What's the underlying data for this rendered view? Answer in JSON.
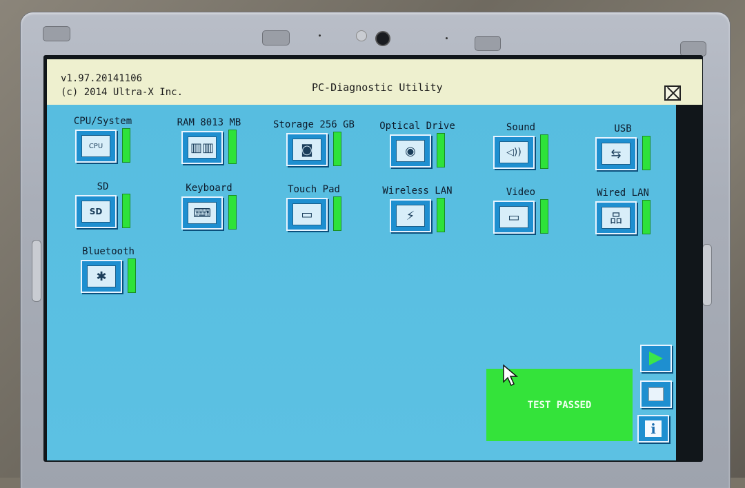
{
  "header": {
    "version": "v1.97.20141106",
    "copyright": "(c) 2014 Ultra-X Inc.",
    "title": "PC-Diagnostic Utility"
  },
  "devices": [
    {
      "label": "CPU/System",
      "icon": "cpu-icon",
      "glyph": "CPU"
    },
    {
      "label": "RAM 8013 MB",
      "icon": "ram-icon",
      "glyph": "▥▥"
    },
    {
      "label": "Storage 256 GB",
      "icon": "storage-icon",
      "glyph": "◙"
    },
    {
      "label": "Optical Drive",
      "icon": "optical-drive-icon",
      "glyph": "◉"
    },
    {
      "label": "Sound",
      "icon": "speaker-icon",
      "glyph": "◁))"
    },
    {
      "label": "USB",
      "icon": "usb-icon",
      "glyph": "⇆"
    },
    {
      "label": "SD",
      "icon": "sd-card-icon",
      "glyph": "SD"
    },
    {
      "label": "Keyboard",
      "icon": "keyboard-icon",
      "glyph": "⌨"
    },
    {
      "label": "Touch Pad",
      "icon": "touchpad-icon",
      "glyph": "▭"
    },
    {
      "label": "Wireless LAN",
      "icon": "wireless-icon",
      "glyph": "⚡"
    },
    {
      "label": "Video",
      "icon": "monitor-icon",
      "glyph": "▭"
    },
    {
      "label": "Wired LAN",
      "icon": "network-icon",
      "glyph": "品"
    },
    {
      "label": "Bluetooth",
      "icon": "bluetooth-icon",
      "glyph": "✱"
    }
  ],
  "status": {
    "result": "TEST PASSED",
    "bar_color": "#2ee23a"
  },
  "controls": {
    "play_icon": "play-icon",
    "stop_icon": "stop-icon",
    "info_glyph": "i"
  }
}
